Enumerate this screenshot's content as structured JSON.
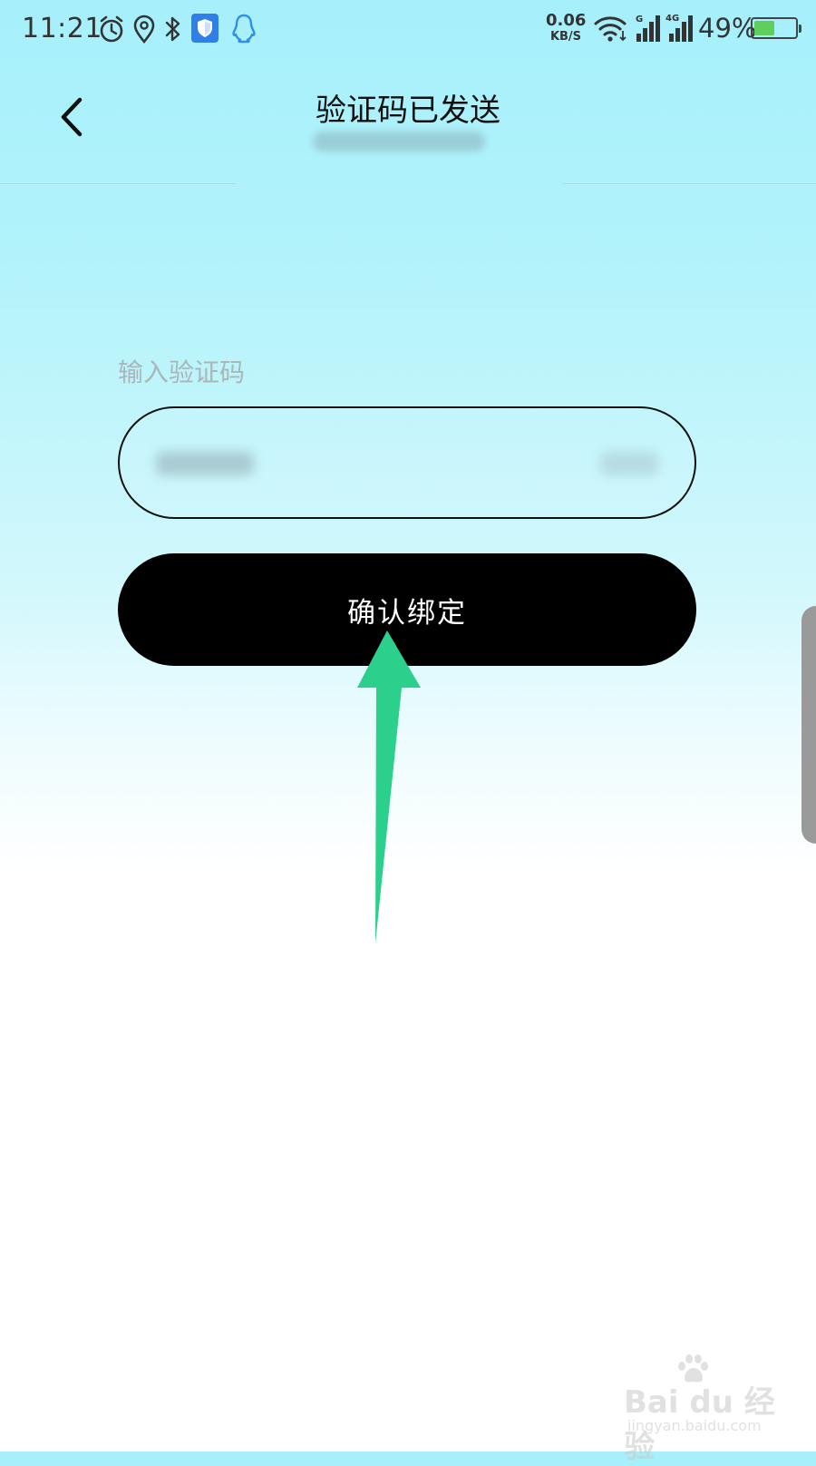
{
  "status_bar": {
    "time": "11:21",
    "net_speed_value": "0.06",
    "net_speed_unit": "KB/S",
    "net_badge_1": "G",
    "net_badge_2": "4G",
    "battery": "49%",
    "battery_level": 0.49,
    "icons": [
      "alarm-icon",
      "location-icon",
      "bluetooth-icon",
      "shield-icon",
      "qq-icon",
      "wifi-icon",
      "signal-icon",
      "battery-icon"
    ]
  },
  "header": {
    "back_icon": "chevron-left-icon",
    "title": "验证码已发送"
  },
  "form": {
    "code_label": "输入验证码"
  },
  "actions": {
    "confirm_label": "确认绑定"
  },
  "annotation": {
    "arrow_color": "#2ad08c"
  },
  "watermark": {
    "brand": "Bai du 经验",
    "url": "jingyan.baidu.com"
  },
  "colors": {
    "background_top": "#a6f0fb",
    "background_bottom": "#ffffff",
    "button_bg": "#000000",
    "button_text": "#ffffff",
    "label_color": "#aab6ba"
  }
}
